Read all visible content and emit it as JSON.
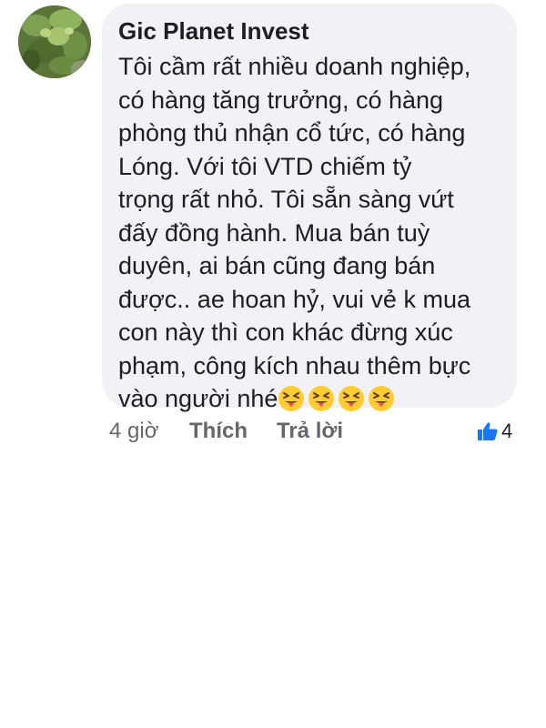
{
  "comment": {
    "author": "Gic Planet Invest",
    "lines": [
      "Tôi cầm rất nhiều doanh nghiệp,",
      "có hàng tăng trưởng, có hàng",
      "phòng thủ nhận cổ tức, có hàng",
      "Lóng. Với tôi VTD chiếm tỷ",
      "trọng rất nhỏ. Tôi sẵn sàng vứt",
      "đấy đồng hành. Mua bán tuỳ",
      "duyên, ai bán cũng đang bán",
      "được.. ae hoan hỷ, vui vẻ k mua",
      "con này thì con khác đừng xúc",
      "phạm, công kích nhau thêm bực",
      "vào người nhé"
    ],
    "emojis": [
      "squinting-tongue-emoji",
      "squinting-tongue-emoji",
      "squinting-tongue-emoji",
      "squinting-tongue-emoji"
    ]
  },
  "actions": {
    "time": "4 giờ",
    "like_label": "Thích",
    "reply_label": "Trả lời",
    "reaction_icon": "thumbs-up-icon",
    "reaction_count": "4"
  },
  "colors": {
    "bubble": "#f0f2f5",
    "text": "#1c1e21",
    "muted": "#65676b",
    "like_blue": "#1877f2",
    "emoji_yellow": "#ffcc33"
  }
}
